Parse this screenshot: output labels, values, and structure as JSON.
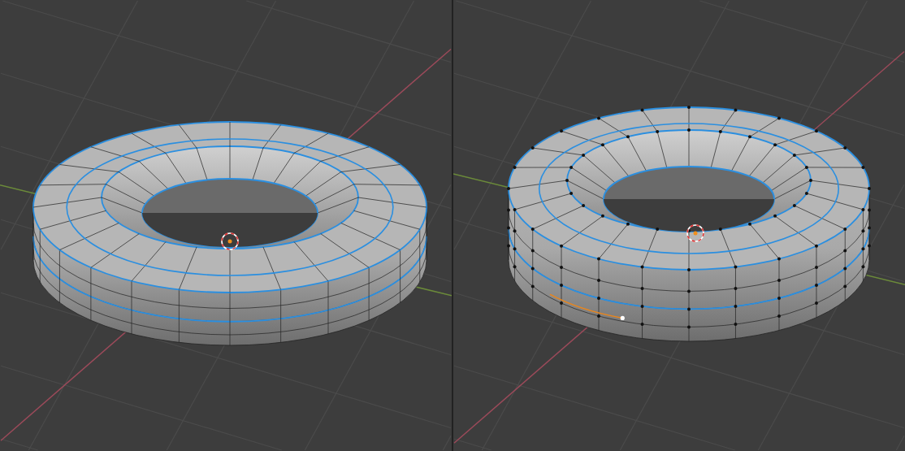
{
  "viewports": [
    {
      "kind": "edges"
    },
    {
      "kind": "vertices"
    }
  ]
}
